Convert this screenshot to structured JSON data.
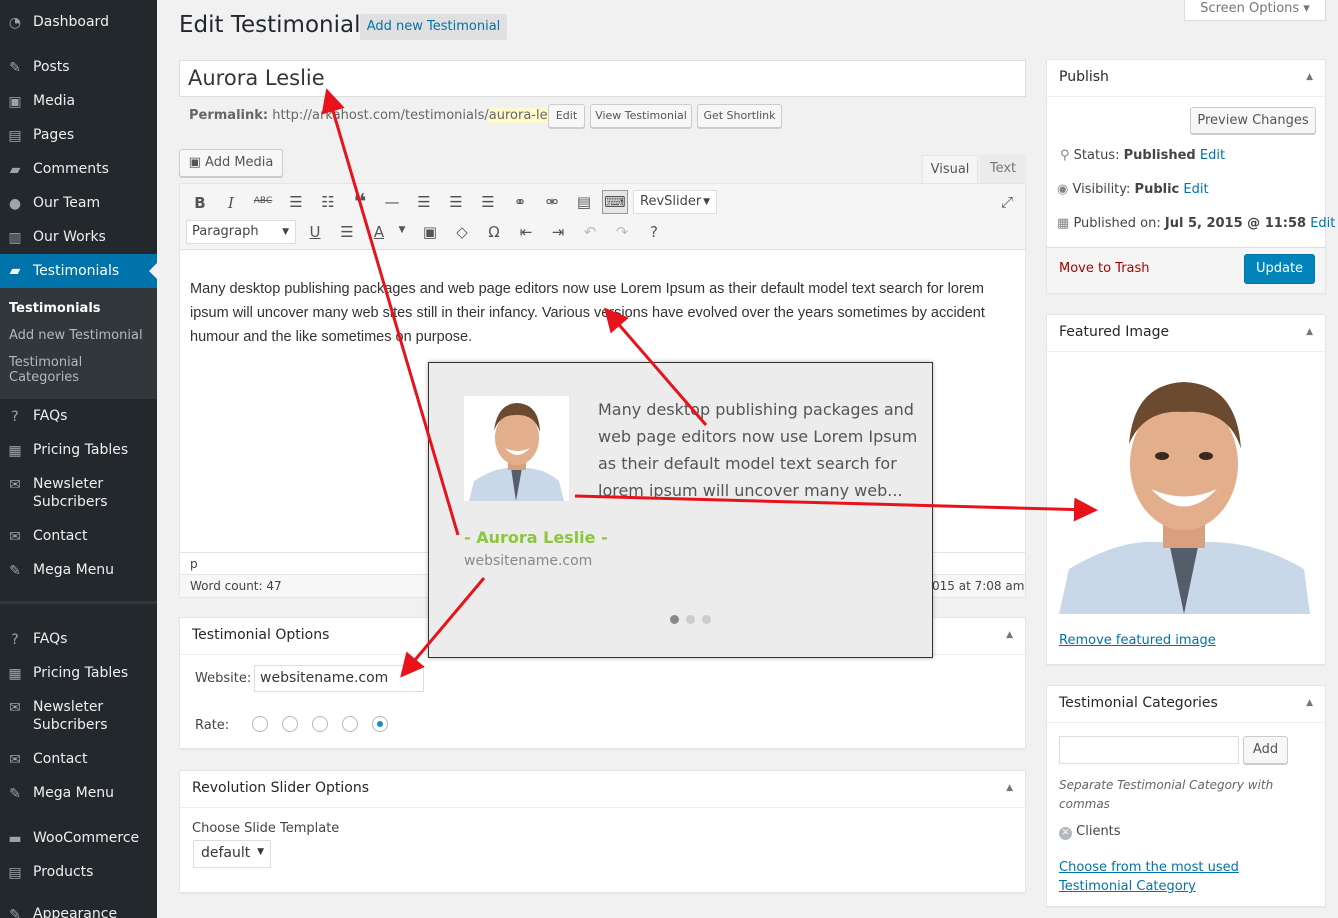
{
  "sidebar": {
    "items": [
      {
        "label": "Dashboard",
        "icon": "dashboard-icon"
      },
      {
        "label": "Posts",
        "icon": "pin-icon"
      },
      {
        "label": "Media",
        "icon": "media-icon"
      },
      {
        "label": "Pages",
        "icon": "pages-icon"
      },
      {
        "label": "Comments",
        "icon": "comments-icon"
      },
      {
        "label": "Our Team",
        "icon": "team-icon"
      },
      {
        "label": "Our Works",
        "icon": "works-icon"
      },
      {
        "label": "Testimonials",
        "icon": "testimonials-icon"
      }
    ],
    "submenu": [
      "Testimonials",
      "Add new Testimonial",
      "Testimonial",
      "Categories"
    ],
    "items2": [
      {
        "label": "FAQs",
        "icon": "question-icon"
      },
      {
        "label": "Pricing Tables",
        "icon": "pricing-icon"
      },
      {
        "label": "Newsleter",
        "label2": "Subcribers",
        "icon": "mail-icon"
      },
      {
        "label": "Contact",
        "icon": "envelope-icon"
      },
      {
        "label": "Mega Menu",
        "icon": "pin-icon"
      },
      {
        "label": "FAQs",
        "icon": "question-icon"
      },
      {
        "label": "Pricing Tables",
        "icon": "pricing-icon"
      },
      {
        "label": "Newsleter",
        "label2": "Subcribers",
        "icon": "mail-icon"
      },
      {
        "label": "Contact",
        "icon": "envelope-icon"
      },
      {
        "label": "Mega Menu",
        "icon": "pin-icon"
      },
      {
        "label": "WooCommerce",
        "icon": "woo-icon"
      },
      {
        "label": "Products",
        "icon": "products-icon"
      },
      {
        "label": "Appearance",
        "icon": "appearance-icon"
      }
    ]
  },
  "header": {
    "title": "Edit Testimonial",
    "add_new": "Add new Testimonial",
    "screen_options": "Screen Options ▾"
  },
  "post": {
    "title": "Aurora Leslie",
    "permalink_label": "Permalink:",
    "permalink_base": "http://arkahost.com/testimonials/",
    "permalink_slug": "aurora-leslie",
    "permalink_end": "/",
    "edit": "Edit",
    "view": "View Testimonial",
    "shortlink": "Get Shortlink"
  },
  "editor": {
    "add_media": "Add Media",
    "tab_visual": "Visual",
    "tab_text": "Text",
    "revslider": "RevSlider",
    "paragraph": "Paragraph",
    "content": "Many desktop publishing packages and web page editors now use Lorem Ipsum as their default model text search for lorem ipsum will uncover many web sites still in their infancy. Various versions have evolved over the years sometimes by accident humour and the like sometimes on purpose.",
    "path": "p",
    "word_count": "Word count: 47",
    "last_edited": "015 at 7:08 am"
  },
  "preview": {
    "text": "Many desktop publishing packages and web page editors now use Lorem Ipsum as their default model text search for lorem ipsum will uncover many web...",
    "name": "- Aurora Leslie -",
    "site": "websitename.com"
  },
  "testimonial_options": {
    "title": "Testimonial Options",
    "website_label": "Website:",
    "website_value": "websitename.com",
    "rate_label": "Rate:",
    "rate": 5
  },
  "rev_options": {
    "title": "Revolution Slider Options",
    "label": "Choose Slide Template",
    "value": "default"
  },
  "publish": {
    "title": "Publish",
    "preview": "Preview Changes",
    "status_label": "Status:",
    "status": "Published",
    "status_edit": "Edit",
    "visibility_label": "Visibility:",
    "visibility": "Public",
    "visibility_edit": "Edit",
    "published_label": "Published on:",
    "published": "Jul 5, 2015 @ 11:58",
    "published_edit": "Edit",
    "trash": "Move to Trash",
    "update": "Update"
  },
  "featured": {
    "title": "Featured Image",
    "remove": "Remove featured image"
  },
  "categories": {
    "title": "Testimonial Categories",
    "add": "Add",
    "hint": "Separate Testimonial Category with commas",
    "tag": "Clients",
    "choose": "Choose from the most used Testimonial Category"
  },
  "colors": {
    "accent": "#0073aa",
    "sidebar": "#23282d",
    "green": "#8cc63f",
    "arrow": "#e8121b",
    "update": "#0085ba"
  }
}
